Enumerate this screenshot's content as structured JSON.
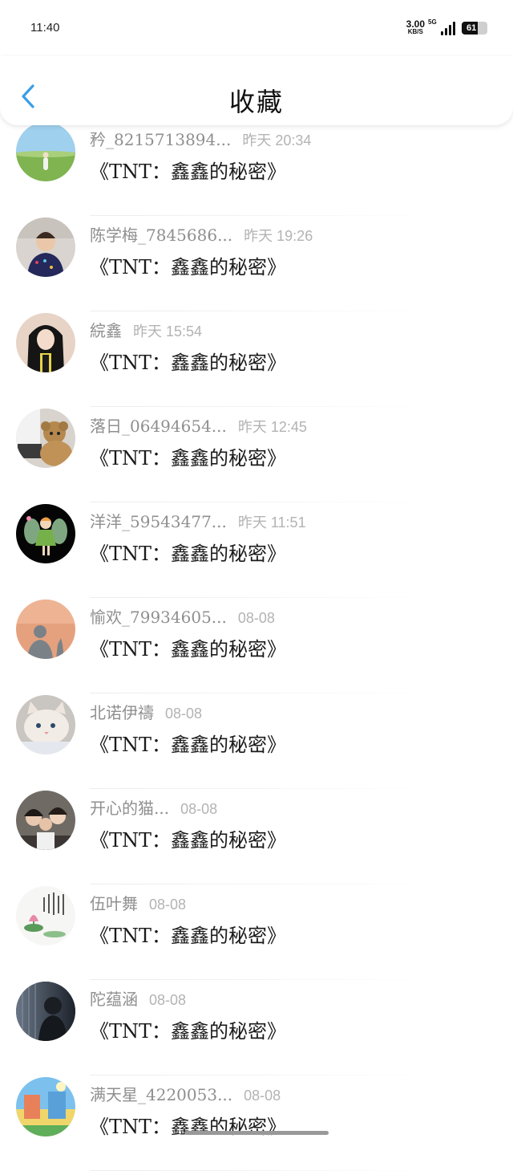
{
  "status_bar": {
    "time": "11:40",
    "speed_value": "3.00",
    "speed_unit": "KB/S",
    "network": "5G",
    "battery": "61",
    "battery_fraction": 0.61
  },
  "header": {
    "title": "收藏",
    "back_icon": "chevron-left-icon",
    "accent_color": "#3a9ee6"
  },
  "favorites": [
    {
      "name": "矜_8215713894...",
      "time": "昨天 20:34",
      "title": "《TNT：鑫鑫的秘密》",
      "avatar": "grassland"
    },
    {
      "name": "陈学梅_7845686...",
      "time": "昨天 19:26",
      "title": "《TNT：鑫鑫的秘密》",
      "avatar": "child"
    },
    {
      "name": "綄鑫",
      "time": "昨天 15:54",
      "title": "《TNT：鑫鑫的秘密》",
      "avatar": "girl"
    },
    {
      "name": "落日_06494654...",
      "time": "昨天 12:45",
      "title": "《TNT：鑫鑫的秘密》",
      "avatar": "teddy"
    },
    {
      "name": "洋洋_59543477...",
      "time": "昨天 11:51",
      "title": "《TNT：鑫鑫的秘密》",
      "avatar": "fairy"
    },
    {
      "name": "愉欢_79934605...",
      "time": "08-08",
      "title": "《TNT：鑫鑫的秘密》",
      "avatar": "silhouette"
    },
    {
      "name": "北诺伊禱",
      "time": "08-08",
      "title": "《TNT：鑫鑫的秘密》",
      "avatar": "cat"
    },
    {
      "name": "开心的猫...",
      "time": "08-08",
      "title": "《TNT：鑫鑫的秘密》",
      "avatar": "group"
    },
    {
      "name": "伍叶舞",
      "time": "08-08",
      "title": "《TNT：鑫鑫的秘密》",
      "avatar": "lotus"
    },
    {
      "name": "陀蕴涵",
      "time": "08-08",
      "title": "《TNT：鑫鑫的秘密》",
      "avatar": "dark"
    },
    {
      "name": "满天星_4220053...",
      "time": "08-08",
      "title": "《TNT：鑫鑫的秘密》",
      "avatar": "cartoon"
    }
  ]
}
